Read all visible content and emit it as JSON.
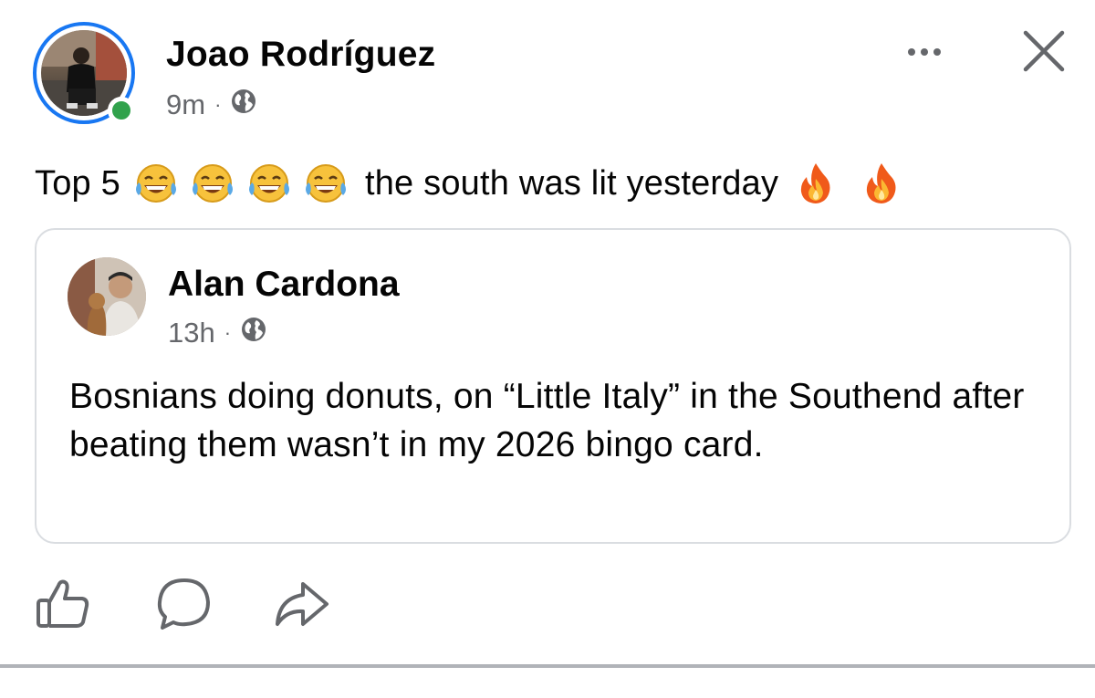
{
  "post": {
    "author": "Joao Rodríguez",
    "time": "9m",
    "separator": "·",
    "audience_icon": "globe-icon",
    "text_before": "Top 5",
    "emoji_laugh": "face-with-tears-of-joy",
    "emoji_laugh_count": 4,
    "text_after": "the south was lit yesterday",
    "emoji_fire": "fire",
    "emoji_fire_count": 2,
    "online": true
  },
  "shared": {
    "author": "Alan Cardona",
    "time": "13h",
    "separator": "·",
    "audience_icon": "globe-icon",
    "text": "Bosnians doing donuts, on “Little Italy” in the Southend after beating them wasn’t in my 2026 bingo card."
  },
  "actions": {
    "like_icon": "thumbs-up-icon",
    "comment_icon": "comment-icon",
    "share_icon": "share-icon"
  },
  "colors": {
    "accent": "#1877f2",
    "online": "#31a24c",
    "meta": "#65676b",
    "border": "#dadde1"
  }
}
